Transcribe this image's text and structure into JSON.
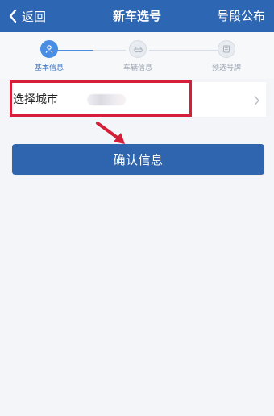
{
  "header": {
    "back_label": "返回",
    "title": "新车选号",
    "action_label": "号段公布",
    "background_color": "#2d66b2"
  },
  "steps": {
    "items": [
      {
        "label": "基本信息",
        "active": true,
        "icon": "person-icon"
      },
      {
        "label": "车辆信息",
        "active": false,
        "icon": "car-icon"
      },
      {
        "label": "预选号牌",
        "active": false,
        "icon": "plate-icon"
      }
    ]
  },
  "form": {
    "city_label": "选择城市",
    "city_value_blurred": true
  },
  "actions": {
    "confirm_label": "确认信息",
    "confirm_color": "#2f65af"
  },
  "annotation": {
    "highlight_color": "#d51f3a"
  }
}
